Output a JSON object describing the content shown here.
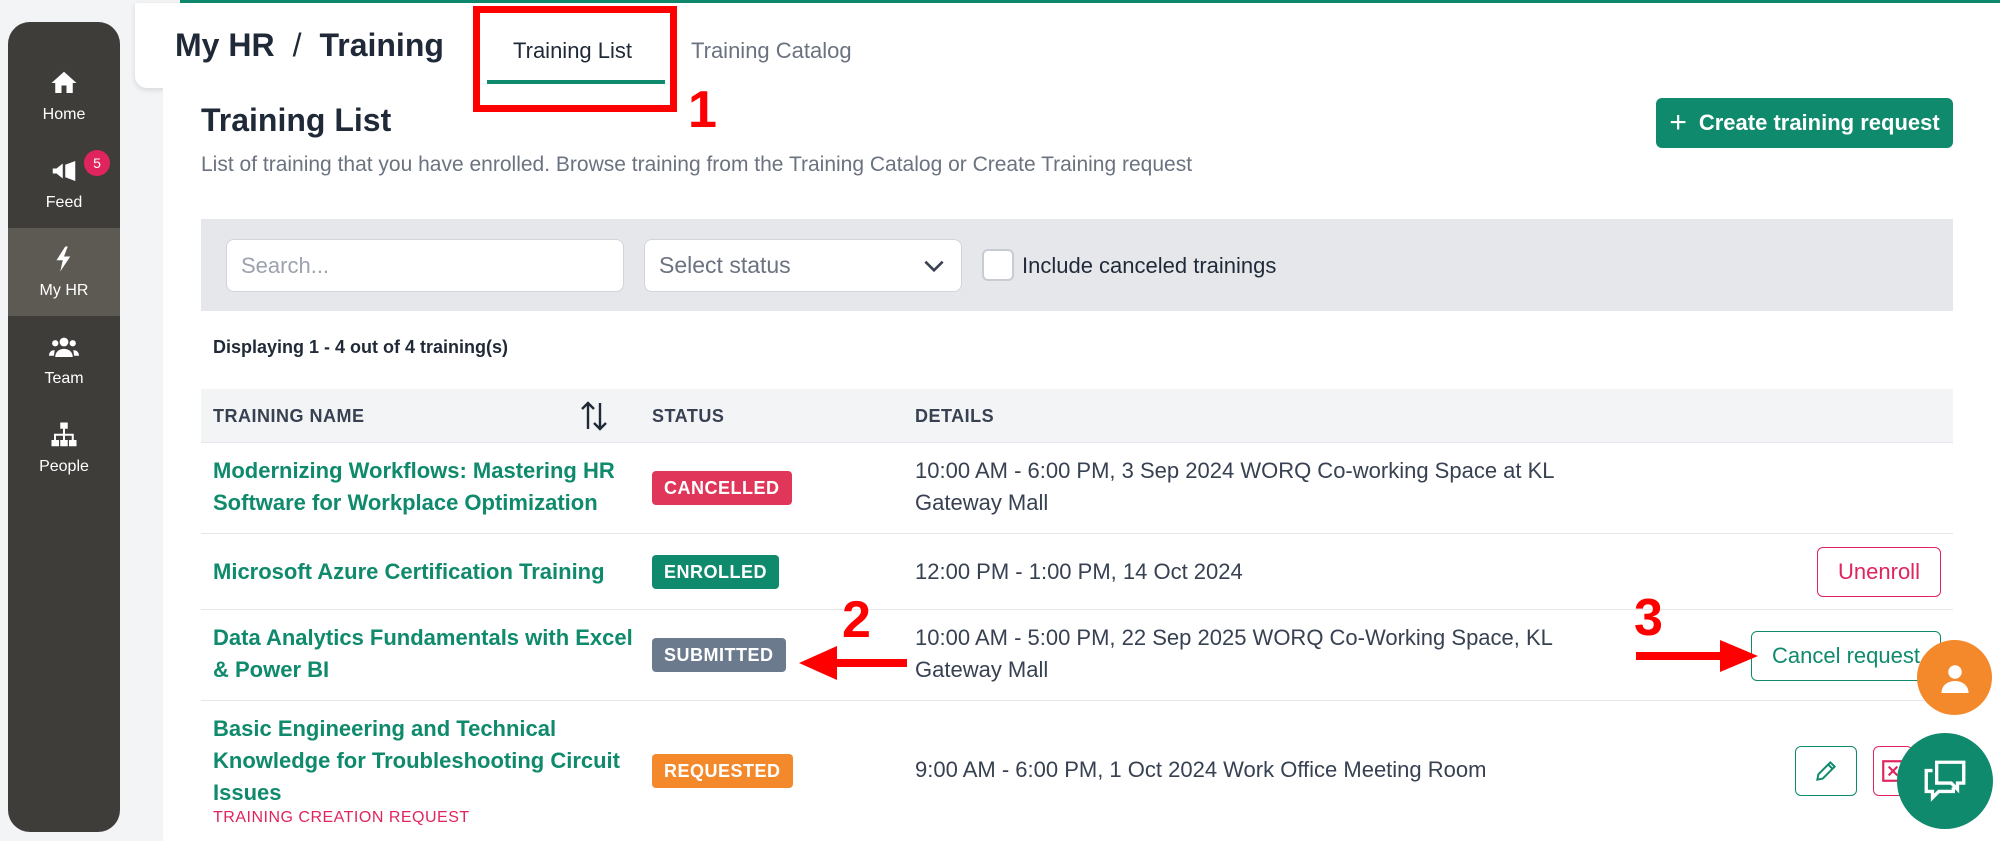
{
  "sidebar": {
    "items": [
      {
        "label": "Home",
        "icon": "home-icon"
      },
      {
        "label": "Feed",
        "icon": "megaphone-icon",
        "badge": "5"
      },
      {
        "label": "My HR",
        "icon": "lightning-icon",
        "active": true
      },
      {
        "label": "Team",
        "icon": "team-icon"
      },
      {
        "label": "People",
        "icon": "org-chart-icon"
      }
    ]
  },
  "header": {
    "breadcrumb_root": "My HR",
    "breadcrumb_sep": "/",
    "breadcrumb_current": "Training",
    "tabs": [
      {
        "label": "Training List",
        "active": true
      },
      {
        "label": "Training Catalog",
        "active": false
      }
    ]
  },
  "annotations": {
    "n1": "1",
    "n2": "2",
    "n3": "3"
  },
  "main": {
    "title": "Training List",
    "subtitle": "List of training that you have enrolled. Browse training from the Training Catalog or Create Training request",
    "create_button": "Create training request",
    "create_plus": "+"
  },
  "filters": {
    "search_placeholder": "Search...",
    "status_placeholder": "Select status",
    "include_canceled": "Include canceled trainings"
  },
  "table": {
    "display_text": "Displaying 1 - 4 out of 4 training(s)",
    "headers": {
      "name": "TRAINING NAME",
      "status": "STATUS",
      "details": "DETAILS"
    },
    "rows": [
      {
        "name_line1": "Modernizing Workflows: Mastering HR",
        "name_line2": "Software for Workplace Optimization",
        "status": "CANCELLED",
        "details_line1": "10:00 AM - 6:00 PM, 3 Sep 2024 WORQ Co-working Space at KL",
        "details_line2": "Gateway Mall"
      },
      {
        "name_line1": "Microsoft Azure Certification Training",
        "status": "ENROLLED",
        "details_line1": "12:00 PM - 1:00 PM, 14 Oct 2024",
        "action": "Unenroll"
      },
      {
        "name_line1": "Data Analytics Fundamentals with Excel",
        "name_line2": "& Power BI",
        "status": "SUBMITTED",
        "details_line1": "10:00 AM - 5:00 PM, 22 Sep 2025 WORQ Co-Working Space, KL",
        "details_line2": "Gateway Mall",
        "action": "Cancel request"
      },
      {
        "name_line1": "Basic Engineering and Technical",
        "name_line2": "Knowledge for Troubleshooting Circuit",
        "name_line3": "Issues",
        "sub_label": "TRAINING CREATION REQUEST",
        "status": "REQUESTED",
        "details_line1": "9:00 AM - 6:00 PM, 1 Oct 2024 Work Office Meeting Room",
        "actions": [
          "edit-icon",
          "delete-icon"
        ]
      }
    ]
  },
  "colors": {
    "brand": "#0f8a6c",
    "cancelled": "#e0365a",
    "enrolled": "#0f8a6c",
    "submitted": "#6b7a8c",
    "requested": "#f4892b",
    "annotation": "#ff0000"
  }
}
